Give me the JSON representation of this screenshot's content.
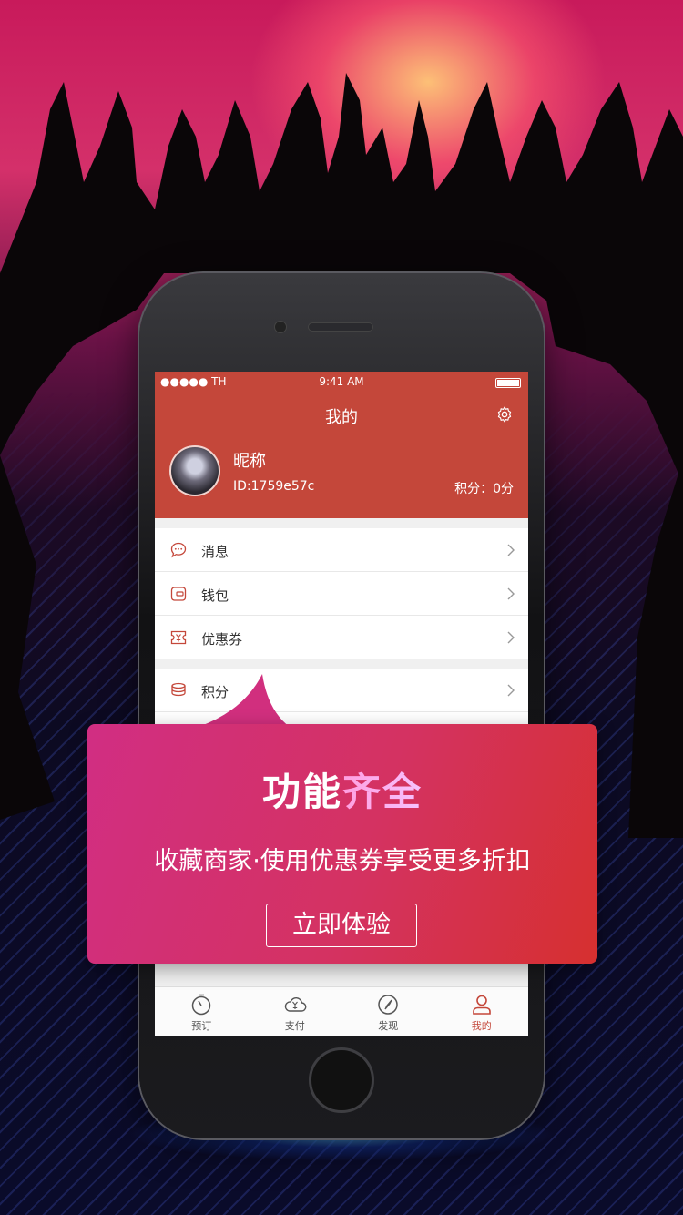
{
  "status_bar": {
    "carrier": "●●●●● TH",
    "time": "9:41 AM"
  },
  "header": {
    "title": "我的"
  },
  "profile": {
    "nickname": "昵称",
    "id_text": "ID:1759e57c",
    "points_text": "积分：0分"
  },
  "menu_group1": [
    {
      "icon": "message-icon",
      "label": "消息"
    },
    {
      "icon": "wallet-icon",
      "label": "钱包"
    },
    {
      "icon": "coupon-icon",
      "label": "优惠券"
    }
  ],
  "menu_group2": [
    {
      "icon": "points-icon",
      "label": "积分"
    }
  ],
  "tabbar": [
    {
      "icon": "timer-icon",
      "label": "预订"
    },
    {
      "icon": "cloud-pay-icon",
      "label": "支付"
    },
    {
      "icon": "compass-icon",
      "label": "发现"
    },
    {
      "icon": "user-icon",
      "label": "我的",
      "active": true
    }
  ],
  "promo": {
    "title_part1": "功能",
    "title_part2": "齐全",
    "subtitle": "收藏商家·使用优惠券享受更多折扣",
    "cta": "立即体验"
  },
  "colors": {
    "header_red": "#c4473a",
    "promo_start": "#d12e83",
    "promo_end": "#d6302f"
  }
}
